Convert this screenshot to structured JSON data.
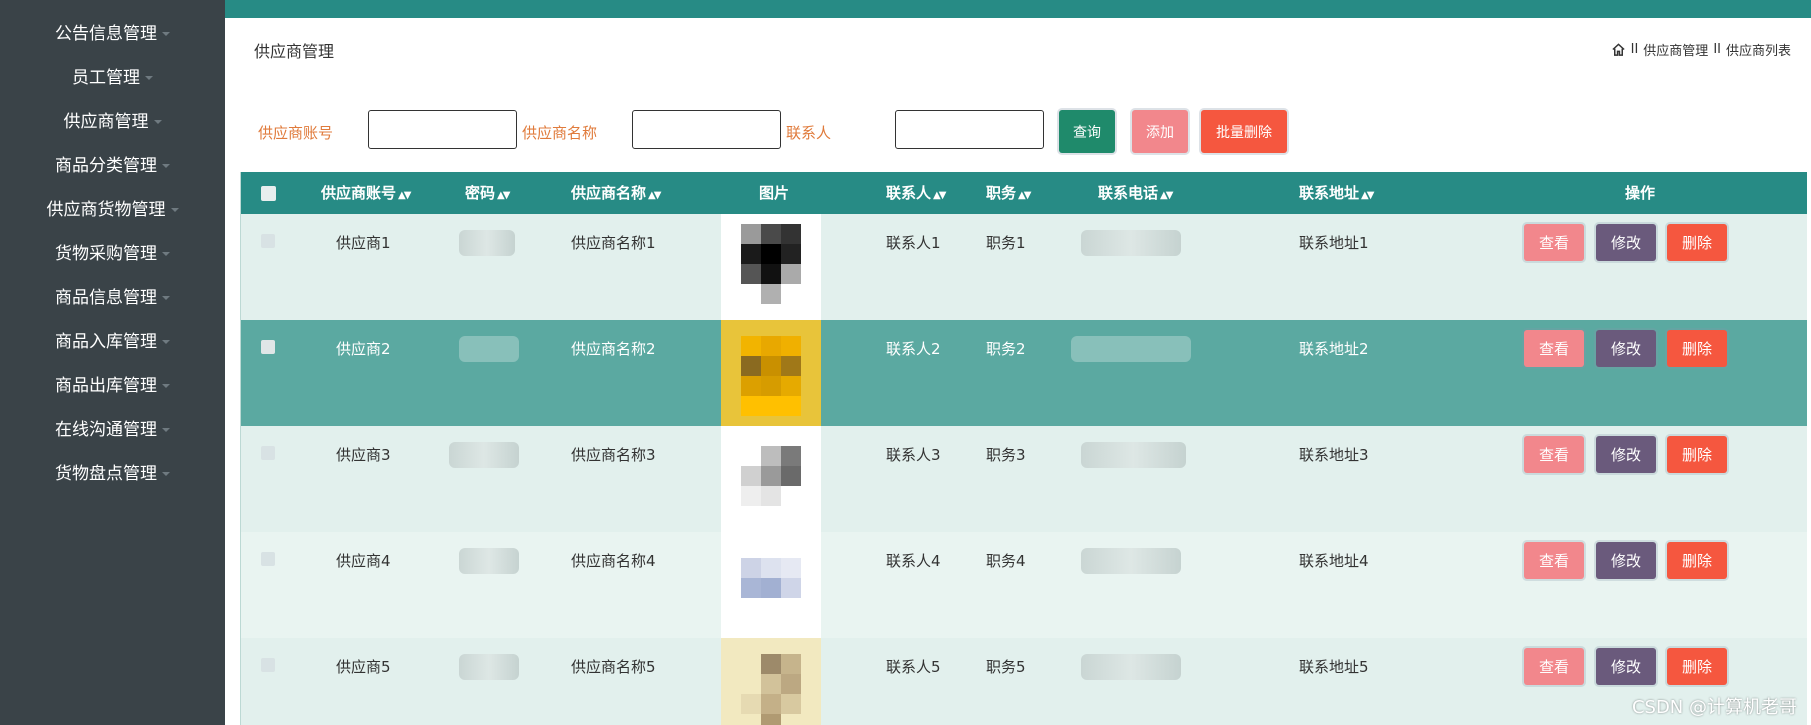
{
  "sidebar": {
    "items": [
      {
        "label": "公告信息管理"
      },
      {
        "label": "员工管理"
      },
      {
        "label": "供应商管理"
      },
      {
        "label": "商品分类管理"
      },
      {
        "label": "供应商货物管理"
      },
      {
        "label": "货物采购管理"
      },
      {
        "label": "商品信息管理"
      },
      {
        "label": "商品入库管理"
      },
      {
        "label": "商品出库管理"
      },
      {
        "label": "在线沟通管理"
      },
      {
        "label": "货物盘点管理"
      }
    ]
  },
  "page": {
    "title": "供应商管理",
    "breadcrumb": [
      "II",
      "供应商管理",
      "II",
      "供应商列表"
    ]
  },
  "search": {
    "account_label": "供应商账号",
    "name_label": "供应商名称",
    "contact_label": "联系人",
    "account_value": "",
    "name_value": "",
    "contact_value": "",
    "query_label": "查询",
    "add_label": "添加",
    "bulk_delete_label": "批量删除"
  },
  "table": {
    "headers": {
      "account": "供应商账号",
      "password": "密码",
      "name": "供应商名称",
      "image": "图片",
      "contact": "联系人",
      "position": "职务",
      "phone": "联系电话",
      "address": "联系地址",
      "actions": "操作"
    },
    "rows": [
      {
        "account": "供应商1",
        "name": "供应商名称1",
        "contact": "联系人1",
        "position": "职务1",
        "address": "联系地址1",
        "view": "查看",
        "edit": "修改",
        "delete": "删除"
      },
      {
        "account": "供应商2",
        "name": "供应商名称2",
        "contact": "联系人2",
        "position": "职务2",
        "address": "联系地址2",
        "view": "查看",
        "edit": "修改",
        "delete": "删除"
      },
      {
        "account": "供应商3",
        "name": "供应商名称3",
        "contact": "联系人3",
        "position": "职务3",
        "address": "联系地址3",
        "view": "查看",
        "edit": "修改",
        "delete": "删除"
      },
      {
        "account": "供应商4",
        "name": "供应商名称4",
        "contact": "联系人4",
        "position": "职务4",
        "address": "联系地址4",
        "view": "查看",
        "edit": "修改",
        "delete": "删除"
      },
      {
        "account": "供应商5",
        "name": "供应商名称5",
        "contact": "联系人5",
        "position": "职务5",
        "address": "联系地址5",
        "view": "查看",
        "edit": "修改",
        "delete": "删除"
      }
    ]
  },
  "colors": {
    "sidebar_bg": "#3a4348",
    "header_teal": "#278b85",
    "row_light": "#e2f0ed",
    "row_highlight": "#5ba9a1",
    "label_orange": "#e07b3c"
  },
  "watermark": "CSDN @计算机老哥"
}
